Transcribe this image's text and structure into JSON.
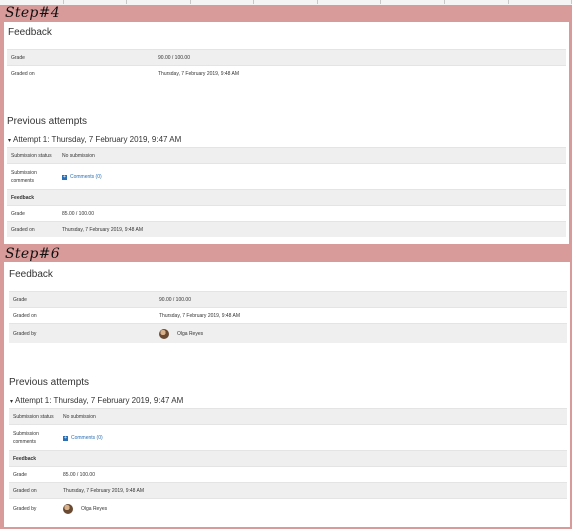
{
  "steps": [
    {
      "label": "Step#4",
      "feedback_title": "Feedback",
      "grade_label": "Grade",
      "grade_value": "90.00 / 100.00",
      "graded_on_label": "Graded on",
      "graded_on_value": "Thursday, 7 February 2019, 9:48 AM",
      "previous_attempts_title": "Previous attempts",
      "attempt_title": "Attempt 1: Thursday, 7 February 2019, 9:47 AM",
      "submission_status_label": "Submission status",
      "submission_status_value": "No submission",
      "submission_comments_label_1": "Submission",
      "submission_comments_label_2": "comments",
      "comments_link": "Comments (0)",
      "attempt_feedback_label": "Feedback",
      "attempt_grade_label": "Grade",
      "attempt_grade_value": "85.00 / 100.00",
      "attempt_graded_on_label": "Graded on",
      "attempt_graded_on_value": "Thursday, 7 February 2019, 9:48 AM"
    },
    {
      "label": "Step#6",
      "feedback_title": "Feedback",
      "grade_label": "Grade",
      "grade_value": "90.00 / 100.00",
      "graded_on_label": "Graded on",
      "graded_on_value": "Thursday, 7 February 2019, 9:48 AM",
      "graded_by_label": "Graded by",
      "graded_by_value": "Olga Reyes",
      "previous_attempts_title": "Previous attempts",
      "attempt_title": "Attempt 1: Thursday, 7 February 2019, 9:47 AM",
      "submission_status_label": "Submission status",
      "submission_status_value": "No submission",
      "submission_comments_label_1": "Submission",
      "submission_comments_label_2": "comments",
      "comments_link": "Comments (0)",
      "attempt_feedback_label": "Feedback",
      "attempt_grade_label": "Grade",
      "attempt_grade_value": "85.00 / 100.00",
      "attempt_graded_on_label": "Graded on",
      "attempt_graded_on_value": "Thursday, 7 February 2019, 9:48 AM",
      "attempt_graded_by_label": "Graded by",
      "attempt_graded_by_value": "Olga Reyes"
    }
  ],
  "colors": {
    "frame": "#d99a9a",
    "row_shade": "#efefef",
    "link": "#2b6fb4"
  }
}
